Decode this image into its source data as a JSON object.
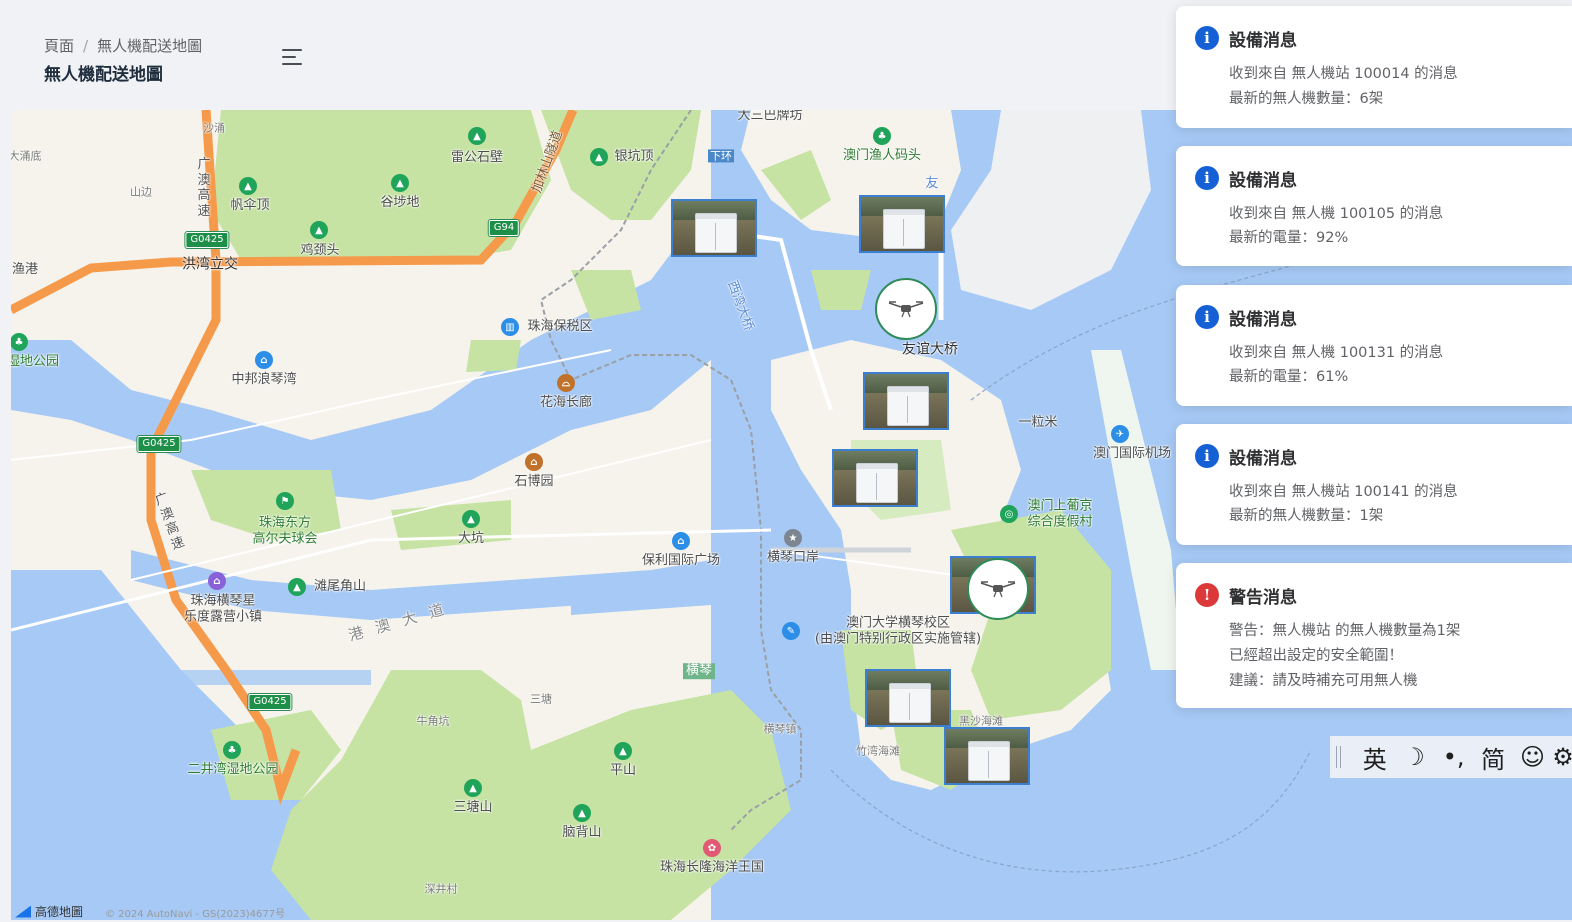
{
  "breadcrumb": {
    "home": "頁面",
    "current": "無人機配送地圖"
  },
  "page_title": "無人機配送地圖",
  "map": {
    "labels": {
      "l1": "大三巴牌坊",
      "l2": "加林山隧道",
      "l3": "雷公石壁",
      "l4": "银坑顶",
      "l5": "下环",
      "l6": "澳门渔人码头",
      "l7": "帆伞顶",
      "l8": "谷埗地",
      "l9": "鸡颈头",
      "l10": "洪湾立交",
      "l11": "西湾大桥",
      "l12": "珠海保税区",
      "l13": "友谊大桥",
      "l14": "中邦浪琴湾",
      "l15": "花海长廊",
      "l16": "一粒米",
      "l17": "澳门国际机场",
      "l18": "石博园",
      "l19": "珠海东方\n高尔夫球会",
      "l20": "大坑",
      "l21": "保利国际广场",
      "l22": "横琴口岸",
      "l23": "澳门上葡京\n综合度假村",
      "l24": "滩尾角山",
      "l25": "珠海横琴星\n乐度露营小镇",
      "l26": "港 澳 大 道",
      "l27": "澳门大学横琴校区\n(由澳门特别行政区实施管辖)",
      "l28": "横琴",
      "l29": "三塘",
      "l30": "牛角坑",
      "l31": "横琴镇",
      "l32": "竹湾海滩",
      "l33": "黑沙海滩",
      "l34": "二井湾湿地公园",
      "l35": "平山",
      "l36": "三塘山",
      "l37": "脑背山",
      "l38": "珠海长隆海洋王国",
      "l39": "深井村",
      "l40": "湿地公园",
      "l41": "渔港",
      "l42": "山边",
      "l43": "沙涌",
      "l44": "大涌底",
      "l45": "广澳高速",
      "l46": "广澳高速",
      "l47": "友"
    },
    "shields": {
      "s1": "G0425",
      "s2": "G94",
      "s3": "G0425",
      "s4": "G0425"
    },
    "logo": "高德地圖",
    "copyright": "© 2024 AutoNavi - GS(2023)4677号"
  },
  "notifications": [
    {
      "type": "info",
      "title": "設備消息",
      "lines": [
        "收到來自 無人機站 100014 的消息",
        "最新的無人機數量：6架"
      ]
    },
    {
      "type": "info",
      "title": "設備消息",
      "lines": [
        "收到來自 無人機 100105 的消息",
        "最新的電量：92%"
      ]
    },
    {
      "type": "info",
      "title": "設備消息",
      "lines": [
        "收到來自 無人機 100131 的消息",
        "最新的電量：61%"
      ]
    },
    {
      "type": "info",
      "title": "設備消息",
      "lines": [
        "收到來自 無人機站 100141 的消息",
        "最新的無人機數量：1架"
      ]
    },
    {
      "type": "warn",
      "title": "警告消息",
      "lines": [
        "警告：無人機站 的無人機數量為1架",
        "已經超出設定的安全範圍！",
        "建議：請及時補充可用無人機"
      ]
    }
  ],
  "ime": {
    "lang": "英",
    "moon": "☽",
    "punct": "•,",
    "simp": "简",
    "emoji": "☺",
    "gear": "⚙"
  },
  "colors": {
    "water": "#a6c9f5",
    "land": "#f5f3ec",
    "green": "#c6e3a4",
    "highway": "#f59a4a",
    "info": "#1660d6",
    "warn": "#dc3a3a",
    "station_border": "#3c7fd0",
    "drone_border": "#2e8b57"
  }
}
